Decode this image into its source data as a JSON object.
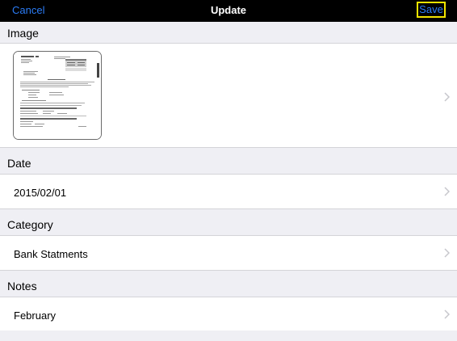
{
  "navbar": {
    "cancel_label": "Cancel",
    "title": "Update",
    "save_label": "Save"
  },
  "sections": {
    "image": {
      "header": "Image"
    },
    "date": {
      "header": "Date",
      "value": "2015/02/01"
    },
    "category": {
      "header": "Category",
      "value": "Bank Statments"
    },
    "notes": {
      "header": "Notes",
      "value": "February"
    }
  },
  "icons": {
    "row_disclosure": "chevron-right-icon"
  },
  "colors": {
    "navbar_bg": "#000000",
    "accent_blue": "#2b7cf6",
    "focus_highlight": "#f2e400",
    "grouped_bg": "#efeff4",
    "chevron": "#c7c7cc"
  }
}
